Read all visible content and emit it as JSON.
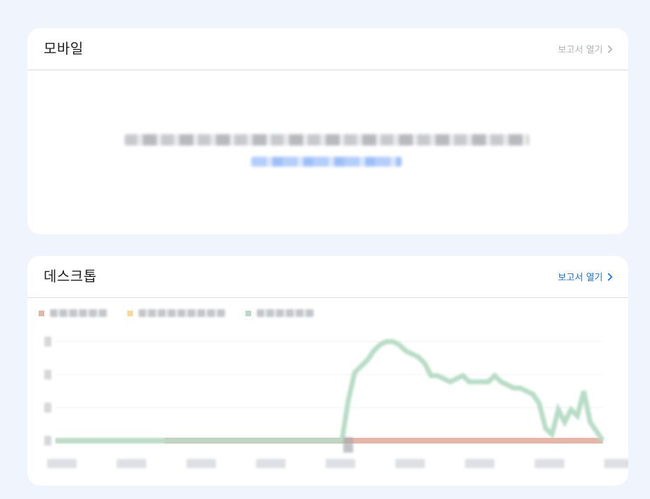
{
  "mobile_card": {
    "title": "모바일",
    "open_report_label": "보고서 열기"
  },
  "desktop_card": {
    "title": "데스크톱",
    "open_report_label": "보고서 열기"
  },
  "colors": {
    "background": "#f0f4fc",
    "card": "#ffffff",
    "link_active": "#1a73e8",
    "link_disabled": "#b0b4b8",
    "series_poor": "#e8b4a5",
    "series_needs_improvement": "#fdd89a",
    "series_good": "#b7dcc6"
  },
  "icons": {
    "open_report": "chevron-right-icon"
  },
  "chart_data": {
    "type": "line",
    "title": "",
    "legend_position": "top-left",
    "grid": true,
    "series": [
      {
        "color": "#e8b4a5",
        "values": [
          0,
          0,
          0,
          0,
          0,
          0,
          0,
          0,
          0,
          0,
          0,
          0,
          0,
          0,
          0,
          0,
          0,
          0,
          0,
          0,
          0,
          0,
          0,
          0,
          0,
          0,
          0,
          0,
          0,
          0,
          0,
          0,
          0,
          0,
          0,
          0,
          0,
          0,
          0,
          0,
          0,
          0,
          0,
          0,
          0,
          0,
          0,
          0,
          0,
          0,
          0,
          0,
          0,
          0,
          0,
          0,
          0,
          0,
          0,
          0,
          0,
          0,
          0,
          0,
          0,
          0,
          0,
          0,
          0,
          0,
          0,
          0,
          0,
          0,
          0,
          0,
          0,
          0,
          0,
          0,
          0,
          0,
          0,
          0,
          0,
          0,
          0
        ]
      },
      {
        "color": "#fdd89a",
        "values": []
      },
      {
        "color": "#b7dcc6",
        "values": [
          0,
          0,
          0,
          0,
          0,
          0,
          0,
          0,
          0,
          0,
          0,
          0,
          0,
          0,
          0,
          0,
          0,
          0,
          0,
          0,
          0,
          0,
          0,
          0,
          0,
          0,
          0,
          0,
          0,
          0,
          0,
          0,
          0,
          0,
          0,
          0,
          0,
          0,
          0,
          0,
          0,
          0,
          0,
          0,
          0,
          0,
          1.3,
          2.2,
          2.4,
          2.6,
          2.9,
          3.1,
          3.2,
          3.2,
          3.1,
          2.9,
          2.8,
          2.7,
          2.5,
          2.1,
          2.1,
          2.0,
          1.9,
          2.0,
          2.1,
          1.9,
          1.9,
          1.9,
          1.9,
          2.1,
          1.9,
          1.8,
          1.7,
          1.7,
          1.6,
          1.5,
          1.2,
          0.4,
          0.2,
          1.0,
          0.6,
          1.0,
          0.8,
          1.6,
          0.6,
          0.3,
          0.0
        ]
      }
    ],
    "y_ticks_count": 4,
    "x_ticks_count": 9
  }
}
